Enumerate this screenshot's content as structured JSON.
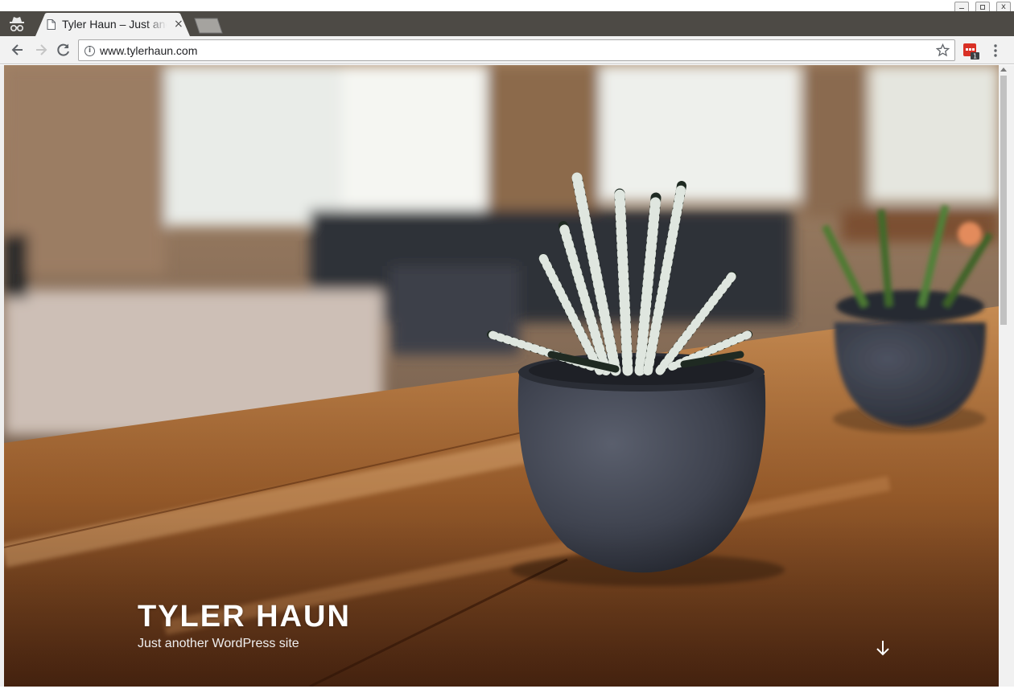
{
  "browser": {
    "tab": {
      "title": "Tyler Haun – Just another WordPress site",
      "close_glyph": "×"
    },
    "toolbar": {
      "url": "www.tylerhaun.com",
      "info_glyph": "i"
    },
    "extension": {
      "badge": "1"
    },
    "window_controls": {
      "close_glyph": "x"
    },
    "icons": [
      "incognito-icon",
      "page-icon",
      "close-icon",
      "back-icon",
      "forward-icon",
      "reload-icon",
      "info-icon",
      "star-icon",
      "extension-icon",
      "menu-icon",
      "arrow-down-icon"
    ]
  },
  "site": {
    "title": "TYLER HAUN",
    "description": "Just another WordPress site"
  },
  "colors": {
    "tabstrip": "#4d4a45",
    "toolbar": "#f2f2f2",
    "active_tab": "#f2f2f2",
    "table_wood": "#a8652f",
    "pot": "#3f434f"
  }
}
